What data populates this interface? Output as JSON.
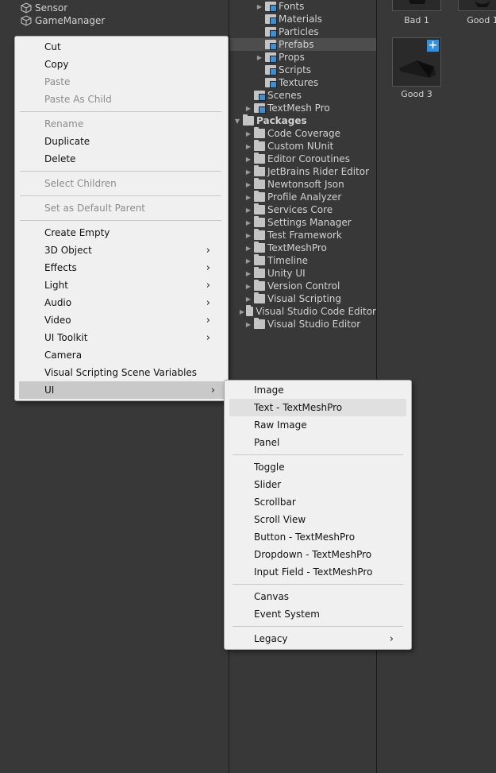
{
  "hierarchy": {
    "items": [
      {
        "label": "Sensor",
        "icon": "cube-icon"
      },
      {
        "label": "GameManager",
        "icon": "cube-icon"
      }
    ]
  },
  "project": {
    "items": [
      {
        "label": "Fonts",
        "icon": "folder-blue",
        "expandable": true
      },
      {
        "label": "Materials",
        "icon": "folder-blue",
        "expandable": false
      },
      {
        "label": "Particles",
        "icon": "folder-blue",
        "expandable": false
      },
      {
        "label": "Prefabs",
        "icon": "folder-blue",
        "expandable": false,
        "selected": true
      },
      {
        "label": "Props",
        "icon": "folder-blue",
        "expandable": true
      },
      {
        "label": "Scripts",
        "icon": "folder-blue",
        "expandable": false
      },
      {
        "label": "Textures",
        "icon": "folder-blue",
        "expandable": false
      },
      {
        "label": "Scenes",
        "icon": "folder-blue",
        "expandable": false
      },
      {
        "label": "TextMesh Pro",
        "icon": "folder-blue",
        "expandable": true
      },
      {
        "label": "Packages",
        "icon": "folder-open",
        "expandable": true,
        "expanded": true,
        "bold": true
      },
      {
        "label": "Code Coverage",
        "icon": "folder-grey",
        "expandable": true
      },
      {
        "label": "Custom NUnit",
        "icon": "folder-grey",
        "expandable": true
      },
      {
        "label": "Editor Coroutines",
        "icon": "folder-grey",
        "expandable": true
      },
      {
        "label": "JetBrains Rider Editor",
        "icon": "folder-grey",
        "expandable": true
      },
      {
        "label": "Newtonsoft Json",
        "icon": "folder-grey",
        "expandable": true
      },
      {
        "label": "Profile Analyzer",
        "icon": "folder-grey",
        "expandable": true
      },
      {
        "label": "Services Core",
        "icon": "folder-grey",
        "expandable": true
      },
      {
        "label": "Settings Manager",
        "icon": "folder-grey",
        "expandable": true
      },
      {
        "label": "Test Framework",
        "icon": "folder-grey",
        "expandable": true
      },
      {
        "label": "TextMeshPro",
        "icon": "folder-grey",
        "expandable": true
      },
      {
        "label": "Timeline",
        "icon": "folder-grey",
        "expandable": true
      },
      {
        "label": "Unity UI",
        "icon": "folder-grey",
        "expandable": true
      },
      {
        "label": "Version Control",
        "icon": "folder-grey",
        "expandable": true
      },
      {
        "label": "Visual Scripting",
        "icon": "folder-grey",
        "expandable": true
      },
      {
        "label": "Visual Studio Code Editor",
        "icon": "folder-grey",
        "expandable": true
      },
      {
        "label": "Visual Studio Editor",
        "icon": "folder-grey",
        "expandable": true
      }
    ]
  },
  "assets": {
    "items": [
      {
        "label": "Bad 1"
      },
      {
        "label": "Good 1"
      },
      {
        "label": "Good 3",
        "add_badge": "+"
      }
    ]
  },
  "context_menu": {
    "items": [
      {
        "label": "Cut",
        "disabled": false
      },
      {
        "label": "Copy",
        "disabled": false
      },
      {
        "label": "Paste",
        "disabled": true
      },
      {
        "label": "Paste As Child",
        "disabled": true
      },
      {
        "separator": true
      },
      {
        "label": "Rename",
        "disabled": true
      },
      {
        "label": "Duplicate",
        "disabled": false
      },
      {
        "label": "Delete",
        "disabled": false
      },
      {
        "separator": true
      },
      {
        "label": "Select Children",
        "disabled": true
      },
      {
        "separator": true
      },
      {
        "label": "Set as Default Parent",
        "disabled": true
      },
      {
        "separator": true
      },
      {
        "label": "Create Empty",
        "disabled": false
      },
      {
        "label": "3D Object",
        "disabled": false,
        "submenu": true
      },
      {
        "label": "Effects",
        "disabled": false,
        "submenu": true
      },
      {
        "label": "Light",
        "disabled": false,
        "submenu": true
      },
      {
        "label": "Audio",
        "disabled": false,
        "submenu": true
      },
      {
        "label": "Video",
        "disabled": false,
        "submenu": true
      },
      {
        "label": "UI Toolkit",
        "disabled": false,
        "submenu": true
      },
      {
        "label": "Camera",
        "disabled": false
      },
      {
        "label": "Visual Scripting Scene Variables",
        "disabled": false
      },
      {
        "label": "UI",
        "disabled": false,
        "submenu": true,
        "active": true
      }
    ]
  },
  "ui_submenu": {
    "items": [
      {
        "label": "Image"
      },
      {
        "label": "Text - TextMeshPro",
        "hover": true
      },
      {
        "label": "Raw Image"
      },
      {
        "label": "Panel"
      },
      {
        "separator": true
      },
      {
        "label": "Toggle"
      },
      {
        "label": "Slider"
      },
      {
        "label": "Scrollbar"
      },
      {
        "label": "Scroll View"
      },
      {
        "label": "Button - TextMeshPro"
      },
      {
        "label": "Dropdown - TextMeshPro"
      },
      {
        "label": "Input Field - TextMeshPro"
      },
      {
        "separator": true
      },
      {
        "label": "Canvas"
      },
      {
        "label": "Event System"
      },
      {
        "separator": true
      },
      {
        "label": "Legacy",
        "submenu": true
      }
    ]
  },
  "colors": {
    "panel_bg": "#383838",
    "menu_bg": "#f0f0f0",
    "folder_accent": "#3c8fd6",
    "badge": "#2f8fe0"
  }
}
